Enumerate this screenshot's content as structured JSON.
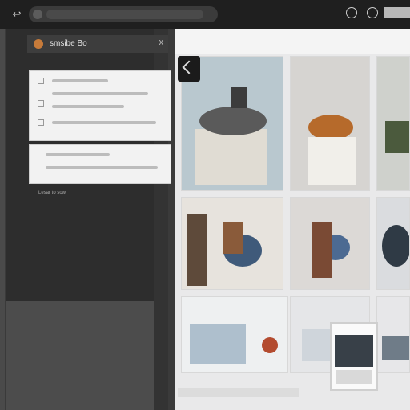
{
  "toolbar": {
    "back_icon": "back-arrow-icon",
    "search_value": ""
  },
  "panel": {
    "title": "smsibe Bo",
    "close_glyph": "x"
  },
  "caption": {
    "line1": "Lesar to sow",
    "line2": ""
  },
  "colors": {
    "panel_bg": "#2d2d2d",
    "gallery_bg": "#e9e9ea",
    "logo": "#c77b3a"
  }
}
